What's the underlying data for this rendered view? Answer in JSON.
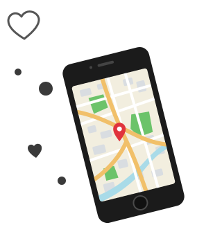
{
  "illustration": {
    "subject": "phone-map-location",
    "colors": {
      "phone_body": "#1b1b1b",
      "map_background": "#f2eedf",
      "road_major": "#f1c06a",
      "road_minor": "#ffffff",
      "park": "#6cc36a",
      "water": "#a9dbe8",
      "building": "#d9dde1",
      "pin": "#e0333d",
      "heart_outline": "#555555",
      "dots": "#3a3a3a"
    },
    "icons": [
      "heart-outline-icon",
      "heart-filled-icon",
      "map-pin-icon"
    ]
  }
}
